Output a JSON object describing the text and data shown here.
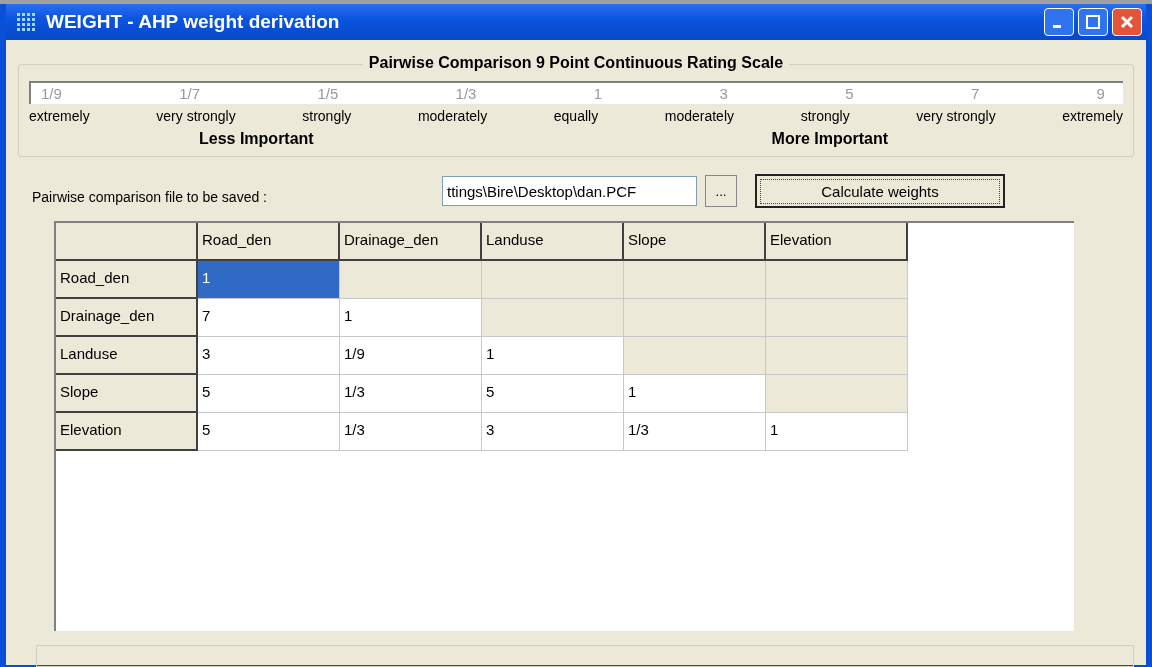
{
  "window": {
    "title": "WEIGHT - AHP weight derivation"
  },
  "scale": {
    "title": "Pairwise Comparison 9 Point Continuous Rating Scale",
    "points": [
      {
        "value": "1/9",
        "label": "extremely"
      },
      {
        "value": "1/7",
        "label": "very strongly"
      },
      {
        "value": "1/5",
        "label": "strongly"
      },
      {
        "value": "1/3",
        "label": "moderately"
      },
      {
        "value": "1",
        "label": "equally"
      },
      {
        "value": "3",
        "label": "moderately"
      },
      {
        "value": "5",
        "label": "strongly"
      },
      {
        "value": "7",
        "label": "very strongly"
      },
      {
        "value": "9",
        "label": "extremely"
      }
    ],
    "less_label": "Less Important",
    "more_label": "More Important"
  },
  "file": {
    "label": "Pairwise comparison file to be saved :",
    "value": "ttings\\Bire\\Desktop\\dan.PCF",
    "browse": "...",
    "button": "Calculate weights"
  },
  "table": {
    "columns": [
      "Road_den",
      "Drainage_den",
      "Landuse",
      "Slope",
      "Elevation"
    ],
    "rows": [
      {
        "header": "Road_den",
        "cells": [
          {
            "value": "1",
            "editable": true,
            "selected": true
          },
          {
            "editable": false,
            "selected": false
          },
          {
            "editable": false,
            "selected": false
          },
          {
            "editable": false,
            "selected": false
          },
          {
            "editable": false,
            "selected": false
          }
        ]
      },
      {
        "header": "Drainage_den",
        "cells": [
          {
            "value": "7",
            "editable": true,
            "selected": false
          },
          {
            "value": "1",
            "editable": true,
            "selected": false
          },
          {
            "editable": false,
            "selected": false
          },
          {
            "editable": false,
            "selected": false
          },
          {
            "editable": false,
            "selected": false
          }
        ]
      },
      {
        "header": "Landuse",
        "cells": [
          {
            "value": "3",
            "editable": true,
            "selected": false
          },
          {
            "value": "1/9",
            "editable": true,
            "selected": false
          },
          {
            "value": "1",
            "editable": true,
            "selected": false
          },
          {
            "editable": false,
            "selected": false
          },
          {
            "editable": false,
            "selected": false
          }
        ]
      },
      {
        "header": "Slope",
        "cells": [
          {
            "value": "5",
            "editable": true,
            "selected": false
          },
          {
            "value": "1/3",
            "editable": true,
            "selected": false
          },
          {
            "value": "5",
            "editable": true,
            "selected": false
          },
          {
            "value": "1",
            "editable": true,
            "selected": false
          },
          {
            "editable": false,
            "selected": false
          }
        ]
      },
      {
        "header": "Elevation",
        "cells": [
          {
            "value": "5",
            "editable": true,
            "selected": false
          },
          {
            "value": "1/3",
            "editable": true,
            "selected": false
          },
          {
            "value": "3",
            "editable": true,
            "selected": false
          },
          {
            "value": "1/3",
            "editable": true,
            "selected": false
          },
          {
            "value": "1",
            "editable": true,
            "selected": false
          }
        ]
      }
    ]
  }
}
